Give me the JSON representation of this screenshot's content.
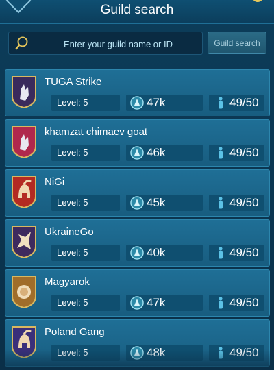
{
  "header": {
    "title": "Guild search"
  },
  "search": {
    "placeholder": "Enter your guild name or ID",
    "button_label": "Guild search"
  },
  "guilds": [
    {
      "name": "TUGA Strike",
      "level": "Level: 5",
      "power": "47k",
      "members": "49/50",
      "emblem": "wolf-icon",
      "emblem_color": "#3a2a5c"
    },
    {
      "name": "khamzat chimaev goat",
      "level": "Level: 5",
      "power": "46k",
      "members": "49/50",
      "emblem": "wolf-icon",
      "emblem_color": "#b0284d"
    },
    {
      "name": "NiGi",
      "level": "Level: 5",
      "power": "45k",
      "members": "49/50",
      "emblem": "spartan-helmet-icon",
      "emblem_color": "#b32a22"
    },
    {
      "name": "UkraineGo",
      "level": "Level: 5",
      "power": "40k",
      "members": "49/50",
      "emblem": "dragon-icon",
      "emblem_color": "#3e2a5e"
    },
    {
      "name": "Magyarok",
      "level": "Level: 5",
      "power": "47k",
      "members": "49/50",
      "emblem": "lion-icon",
      "emblem_color": "#a06d2a"
    },
    {
      "name": "Poland Gang",
      "level": "Level: 5",
      "power": "48k",
      "members": "49/50",
      "emblem": "spartan-helmet-icon",
      "emblem_color": "#3a2f7a"
    }
  ]
}
